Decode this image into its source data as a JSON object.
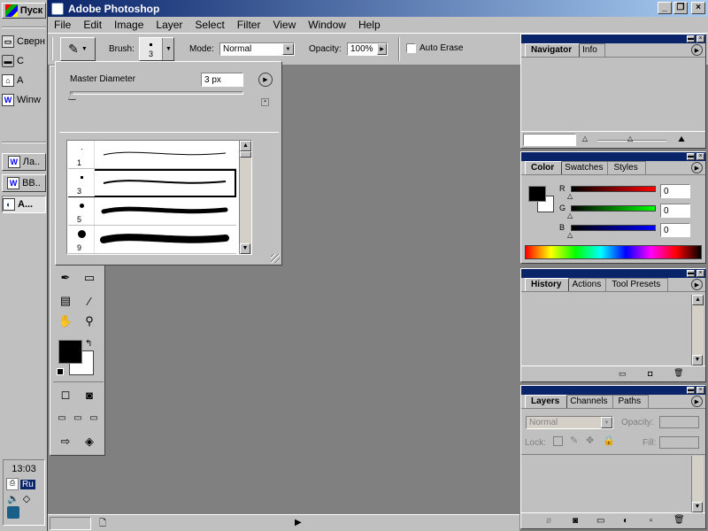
{
  "taskbar": {
    "start_label": "Пуск",
    "quicklaunch": [
      {
        "label": "Сверн",
        "icon": "desktop-icon"
      },
      {
        "label": "С",
        "icon": "drive-icon"
      },
      {
        "label": "А",
        "icon": "network-icon"
      },
      {
        "label": "Winw",
        "icon": "word-icon"
      }
    ],
    "tasks": [
      {
        "label": "Ла..",
        "icon": "word-icon"
      },
      {
        "label": "ВВ..",
        "icon": "word-icon"
      },
      {
        "label": "А...",
        "icon": "photoshop-icon"
      }
    ],
    "clock": "13:03",
    "lang": "Ru"
  },
  "window": {
    "title": "Adobe Photoshop",
    "menus": [
      "File",
      "Edit",
      "Image",
      "Layer",
      "Select",
      "Filter",
      "View",
      "Window",
      "Help"
    ]
  },
  "options": {
    "brush_label": "Brush:",
    "brush_size": "3",
    "mode_label": "Mode:",
    "mode_value": "Normal",
    "opacity_label": "Opacity:",
    "opacity_value": "100%",
    "auto_erase_label": "Auto Erase"
  },
  "brush_popup": {
    "master_label": "Master Diameter",
    "master_value": "3 px",
    "presets": [
      "1",
      "3",
      "5",
      "9"
    ]
  },
  "navigator": {
    "tabs": [
      "Navigator",
      "Info"
    ]
  },
  "color": {
    "tabs": [
      "Color",
      "Swatches",
      "Styles"
    ],
    "channels": [
      {
        "name": "R",
        "value": "0",
        "color": "#ff0000"
      },
      {
        "name": "G",
        "value": "0",
        "color": "#00ff00"
      },
      {
        "name": "B",
        "value": "0",
        "color": "#0000ff"
      }
    ]
  },
  "history": {
    "tabs": [
      "History",
      "Actions",
      "Tool Presets"
    ]
  },
  "layers": {
    "tabs": [
      "Layers",
      "Channels",
      "Paths"
    ],
    "blend_mode": "Normal",
    "opacity_label": "Opacity:",
    "lock_label": "Lock:",
    "fill_label": "Fill:"
  },
  "colors": {
    "title_start": "#0a246a",
    "title_end": "#a6caf0",
    "face": "#c0c0c0",
    "workspace": "#808080"
  }
}
